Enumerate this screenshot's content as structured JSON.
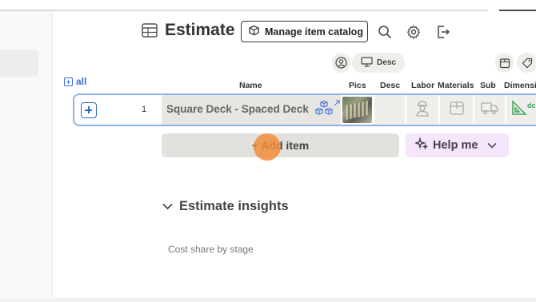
{
  "header": {
    "title": "Estimate",
    "manage_catalog_label": "Manage item catalog",
    "icons": [
      "table-icon",
      "box-icon",
      "search-icon",
      "gear-icon",
      "export-icon"
    ]
  },
  "column_toggles": {
    "desc_label": "Desc"
  },
  "table": {
    "all_label": "all",
    "columns": [
      "Name",
      "Pics",
      "Desc",
      "Labor",
      "Materials",
      "Sub",
      "Dimension"
    ],
    "rows": [
      {
        "number": "1",
        "name": "Square Deck - Spaced Deck",
        "dimension_label": "dc"
      }
    ]
  },
  "actions": {
    "add_item_label": "+ Add item",
    "help_label": "Help me"
  },
  "insights": {
    "title": "Estimate insights",
    "cost_share_label": "Cost share by stage"
  },
  "colors": {
    "accent_blue": "#2f66c9",
    "row_border": "#8fb0ea",
    "help_bg": "#f5e6fb",
    "cursor_orange": "#f08c3c",
    "dimension_green": "#3ca65a"
  }
}
